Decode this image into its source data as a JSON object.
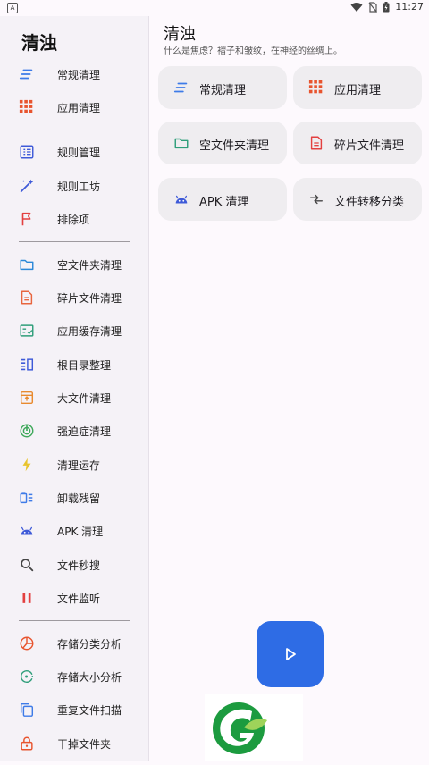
{
  "status_bar": {
    "time": "11:27",
    "left_badge": "A"
  },
  "sidebar": {
    "title": "清浊",
    "groups": [
      [
        {
          "label": "常规清理",
          "icon": "lines-icon",
          "color": "#3e7be8"
        },
        {
          "label": "应用清理",
          "icon": "grid-icon",
          "color": "#e8542e"
        }
      ],
      [
        {
          "label": "规则管理",
          "icon": "list-icon",
          "color": "#3e5ad8"
        },
        {
          "label": "规则工坊",
          "icon": "wand-icon",
          "color": "#3e5ad8"
        },
        {
          "label": "排除项",
          "icon": "flag-icon",
          "color": "#e34040"
        }
      ],
      [
        {
          "label": "空文件夹清理",
          "icon": "folder-icon",
          "color": "#2b88d8"
        },
        {
          "label": "碎片文件清理",
          "icon": "document-icon",
          "color": "#e8653e"
        },
        {
          "label": "应用缓存清理",
          "icon": "checklist-icon",
          "color": "#2f9e7a"
        },
        {
          "label": "根目录整理",
          "icon": "columns-icon",
          "color": "#3e5ad8"
        },
        {
          "label": "大文件清理",
          "icon": "package-icon",
          "color": "#e88a2e"
        },
        {
          "label": "强迫症清理",
          "icon": "target-icon",
          "color": "#3ea85a"
        },
        {
          "label": "清理运存",
          "icon": "bolt-icon",
          "color": "#e8c42e"
        },
        {
          "label": "卸载残留",
          "icon": "uninstall-icon",
          "color": "#3e7be8"
        },
        {
          "label": "APK 清理",
          "icon": "android-icon",
          "color": "#3e5ad8"
        },
        {
          "label": "文件秒搜",
          "icon": "search-icon",
          "color": "#444444"
        },
        {
          "label": "文件监听",
          "icon": "pause-icon",
          "color": "#e34040"
        }
      ],
      [
        {
          "label": "存储分类分析",
          "icon": "pie-icon",
          "color": "#e8542e"
        },
        {
          "label": "存储大小分析",
          "icon": "size-icon",
          "color": "#2f9e7a"
        },
        {
          "label": "重复文件扫描",
          "icon": "copy-icon",
          "color": "#3e7be8"
        },
        {
          "label": "干掉文件夹",
          "icon": "lock-icon",
          "color": "#e8542e"
        }
      ]
    ]
  },
  "main": {
    "title": "清浊",
    "subtitle": "什么是焦虑？褶子和皱纹，在神经的丝绸上。",
    "cards": [
      {
        "label": "常规清理",
        "icon": "lines-icon",
        "color": "#3e7be8"
      },
      {
        "label": "应用清理",
        "icon": "grid-icon",
        "color": "#e8542e"
      },
      {
        "label": "空文件夹清理",
        "icon": "folder-icon",
        "color": "#2f9e7a"
      },
      {
        "label": "碎片文件清理",
        "icon": "document-icon",
        "color": "#e34040"
      },
      {
        "label": "APK 清理",
        "icon": "android-icon",
        "color": "#3e5ad8"
      },
      {
        "label": "文件转移分类",
        "icon": "transfer-icon",
        "color": "#444444"
      }
    ]
  },
  "fab": {
    "icon": "play-icon",
    "color": "#2e6ce5"
  }
}
